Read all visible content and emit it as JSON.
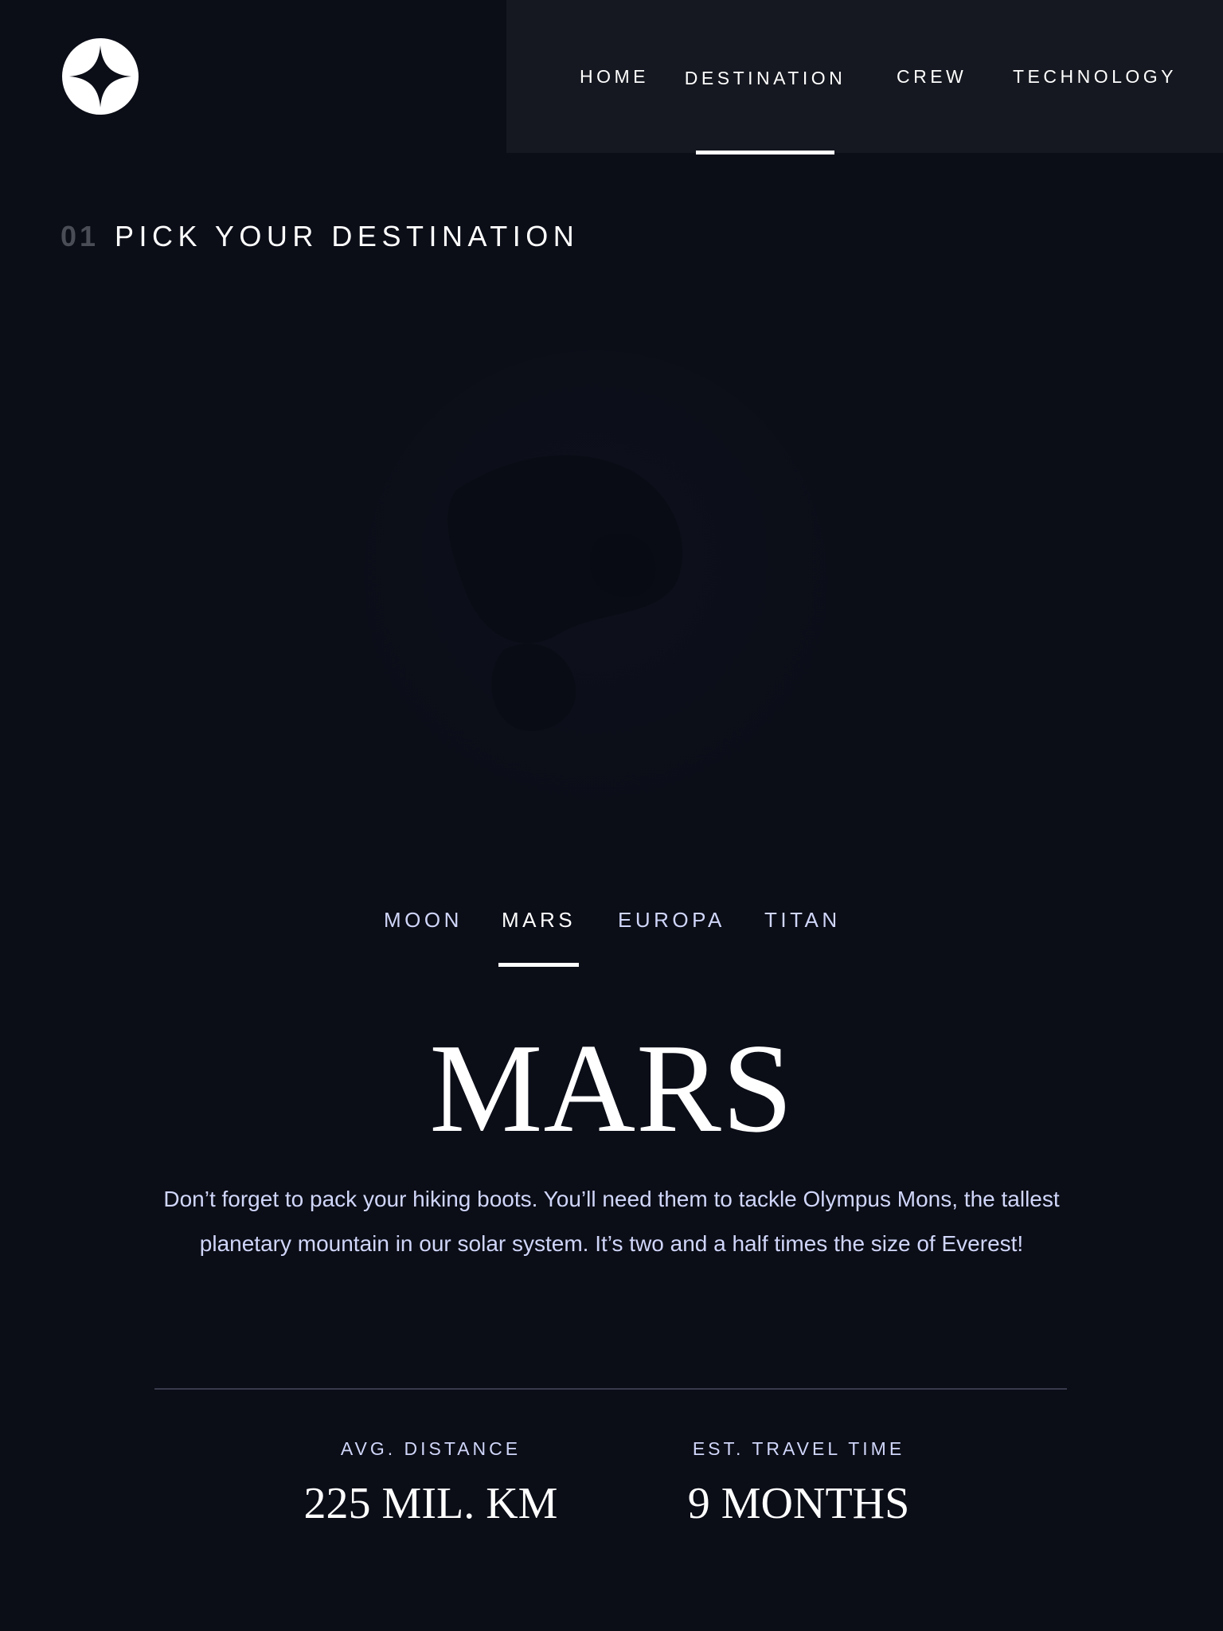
{
  "logo": {
    "icon": "star-logo-icon"
  },
  "nav": {
    "items": [
      {
        "label": "HOME",
        "active": false
      },
      {
        "label": "DESTINATION",
        "active": true
      },
      {
        "label": "CREW",
        "active": false
      },
      {
        "label": "TECHNOLOGY",
        "active": false
      }
    ]
  },
  "heading": {
    "number": "01",
    "text": "PICK YOUR DESTINATION"
  },
  "planet": {
    "name": "mars-image"
  },
  "tabs": {
    "items": [
      {
        "label": "MOON",
        "active": false
      },
      {
        "label": "MARS",
        "active": true
      },
      {
        "label": "EUROPA",
        "active": false
      },
      {
        "label": "TITAN",
        "active": false
      }
    ]
  },
  "destination": {
    "name": "MARS",
    "description": "Don’t forget to pack your hiking boots. You’ll need them to tackle Olympus Mons, the tallest planetary mountain in our solar system. It’s two and a half times the size of Everest!"
  },
  "stats": {
    "distance": {
      "label": "AVG. DISTANCE",
      "value": "225 MIL. KM"
    },
    "travel": {
      "label": "EST. TRAVEL TIME",
      "value": "9 MONTHS"
    }
  },
  "colors": {
    "background": "#0b0d17",
    "nav_background": "#151820",
    "accent_text": "#d0d6f9",
    "white": "#ffffff"
  }
}
